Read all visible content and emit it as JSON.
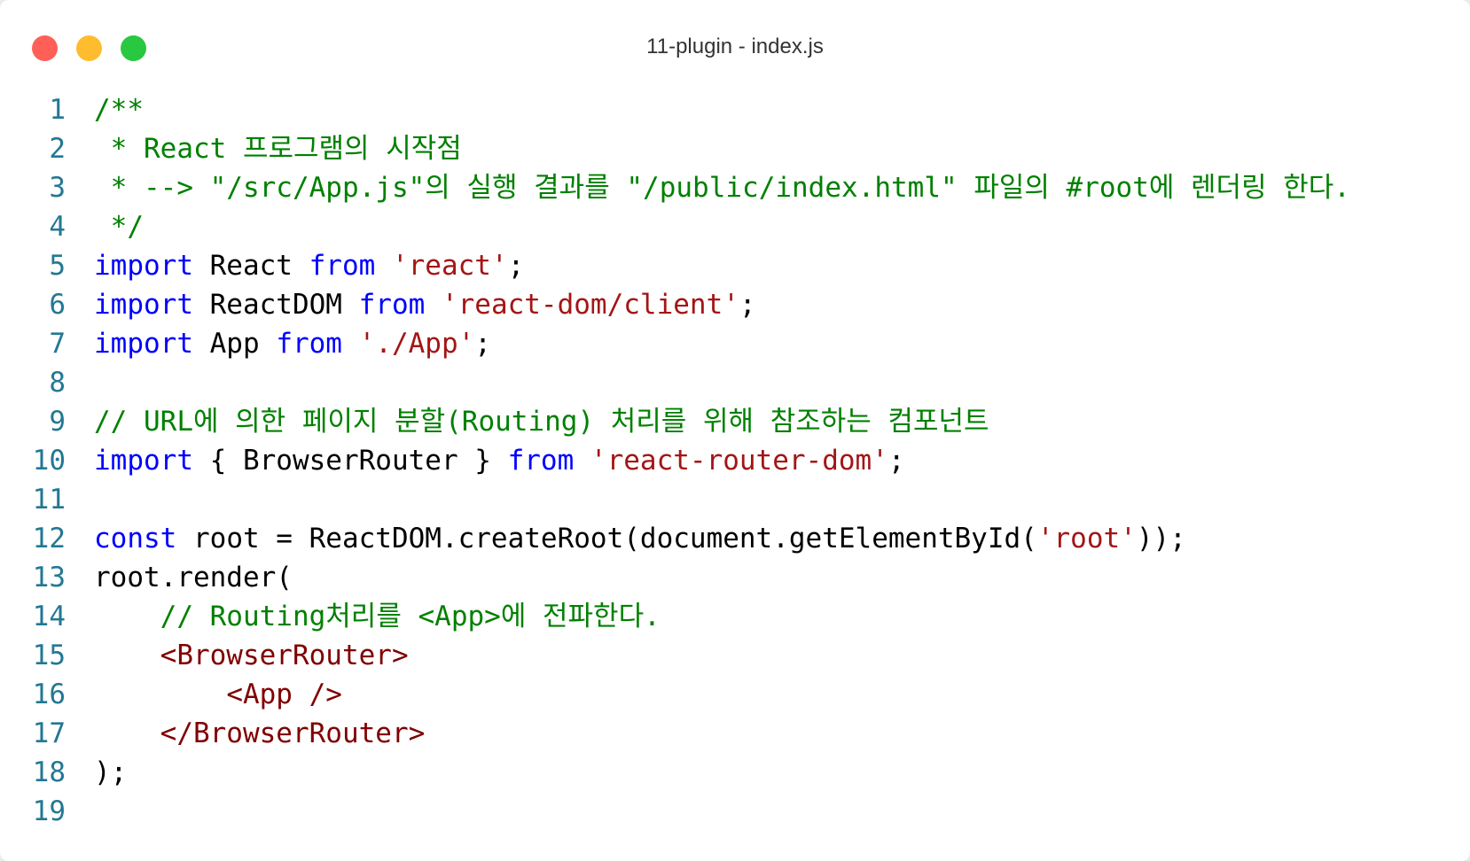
{
  "window": {
    "title": "11-plugin - index.js",
    "controls": [
      {
        "name": "close-button",
        "color": "#ff5f57"
      },
      {
        "name": "minimize-button",
        "color": "#febc2e"
      },
      {
        "name": "maximize-button",
        "color": "#28c840"
      }
    ]
  },
  "colors": {
    "comment": "#008000",
    "keyword": "#0000ff",
    "string": "#a31515",
    "tag": "#800000",
    "line_number": "#237893"
  },
  "lines": [
    {
      "n": "1",
      "tokens": [
        {
          "t": "/**",
          "c": "comment"
        }
      ]
    },
    {
      "n": "2",
      "tokens": [
        {
          "t": " * React 프로그램의 시작점",
          "c": "comment"
        }
      ]
    },
    {
      "n": "3",
      "tokens": [
        {
          "t": " * --> \"/src/App.js\"의 실행 결과를 \"/public/index.html\" 파일의 #root에 렌더링 한다.",
          "c": "comment"
        }
      ]
    },
    {
      "n": "4",
      "tokens": [
        {
          "t": " */",
          "c": "comment"
        }
      ]
    },
    {
      "n": "5",
      "tokens": [
        {
          "t": "import",
          "c": "keyword"
        },
        {
          "t": " React ",
          "c": "plain"
        },
        {
          "t": "from",
          "c": "keyword"
        },
        {
          "t": " ",
          "c": "plain"
        },
        {
          "t": "'react'",
          "c": "string"
        },
        {
          "t": ";",
          "c": "plain"
        }
      ]
    },
    {
      "n": "6",
      "tokens": [
        {
          "t": "import",
          "c": "keyword"
        },
        {
          "t": " ReactDOM ",
          "c": "plain"
        },
        {
          "t": "from",
          "c": "keyword"
        },
        {
          "t": " ",
          "c": "plain"
        },
        {
          "t": "'react-dom/client'",
          "c": "string"
        },
        {
          "t": ";",
          "c": "plain"
        }
      ]
    },
    {
      "n": "7",
      "tokens": [
        {
          "t": "import",
          "c": "keyword"
        },
        {
          "t": " App ",
          "c": "plain"
        },
        {
          "t": "from",
          "c": "keyword"
        },
        {
          "t": " ",
          "c": "plain"
        },
        {
          "t": "'./App'",
          "c": "string"
        },
        {
          "t": ";",
          "c": "plain"
        }
      ]
    },
    {
      "n": "8",
      "tokens": []
    },
    {
      "n": "9",
      "tokens": [
        {
          "t": "// URL에 의한 페이지 분할(Routing) 처리를 위해 참조하는 컴포넌트",
          "c": "comment"
        }
      ]
    },
    {
      "n": "10",
      "tokens": [
        {
          "t": "import",
          "c": "keyword"
        },
        {
          "t": " { BrowserRouter } ",
          "c": "plain"
        },
        {
          "t": "from",
          "c": "keyword"
        },
        {
          "t": " ",
          "c": "plain"
        },
        {
          "t": "'react-router-dom'",
          "c": "string"
        },
        {
          "t": ";",
          "c": "plain"
        }
      ]
    },
    {
      "n": "11",
      "tokens": []
    },
    {
      "n": "12",
      "tokens": [
        {
          "t": "const",
          "c": "keyword"
        },
        {
          "t": " root = ReactDOM.createRoot(document.getElementById(",
          "c": "plain"
        },
        {
          "t": "'root'",
          "c": "string"
        },
        {
          "t": "));",
          "c": "plain"
        }
      ]
    },
    {
      "n": "13",
      "tokens": [
        {
          "t": "root.render(",
          "c": "plain"
        }
      ]
    },
    {
      "n": "14",
      "tokens": [
        {
          "t": "    ",
          "c": "plain"
        },
        {
          "t": "// Routing처리를 <App>에 전파한다.",
          "c": "comment"
        }
      ]
    },
    {
      "n": "15",
      "tokens": [
        {
          "t": "    ",
          "c": "plain"
        },
        {
          "t": "<BrowserRouter>",
          "c": "tag"
        }
      ]
    },
    {
      "n": "16",
      "tokens": [
        {
          "t": "        ",
          "c": "plain"
        },
        {
          "t": "<App />",
          "c": "tag"
        }
      ]
    },
    {
      "n": "17",
      "tokens": [
        {
          "t": "    ",
          "c": "plain"
        },
        {
          "t": "</BrowserRouter>",
          "c": "tag"
        }
      ]
    },
    {
      "n": "18",
      "tokens": [
        {
          "t": ");",
          "c": "plain"
        }
      ]
    },
    {
      "n": "19",
      "tokens": []
    }
  ]
}
